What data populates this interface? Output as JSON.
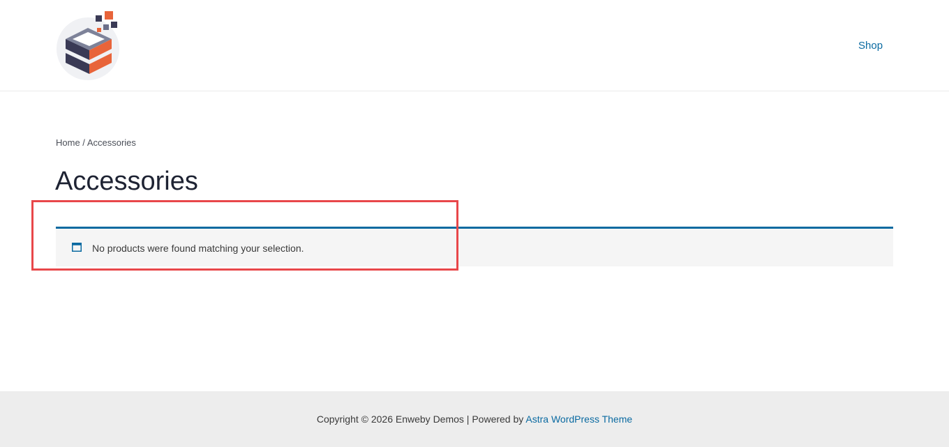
{
  "header": {
    "logo_name": "cube-logo",
    "nav": [
      {
        "label": "Shop"
      }
    ]
  },
  "breadcrumb": {
    "home": "Home",
    "separator": " / ",
    "current": "Accessories"
  },
  "page": {
    "title": "Accessories"
  },
  "notice": {
    "icon": "browser-window-icon",
    "message": "No products were found matching your selection."
  },
  "footer": {
    "copyright": "Copyright © 2026 Enweby Demos | Powered by ",
    "link_label": "Astra WordPress Theme"
  },
  "colors": {
    "accent": "#0a6aa1",
    "highlight": "#e8474a",
    "logo_orange": "#e8643a",
    "logo_navy": "#3a3a55"
  }
}
